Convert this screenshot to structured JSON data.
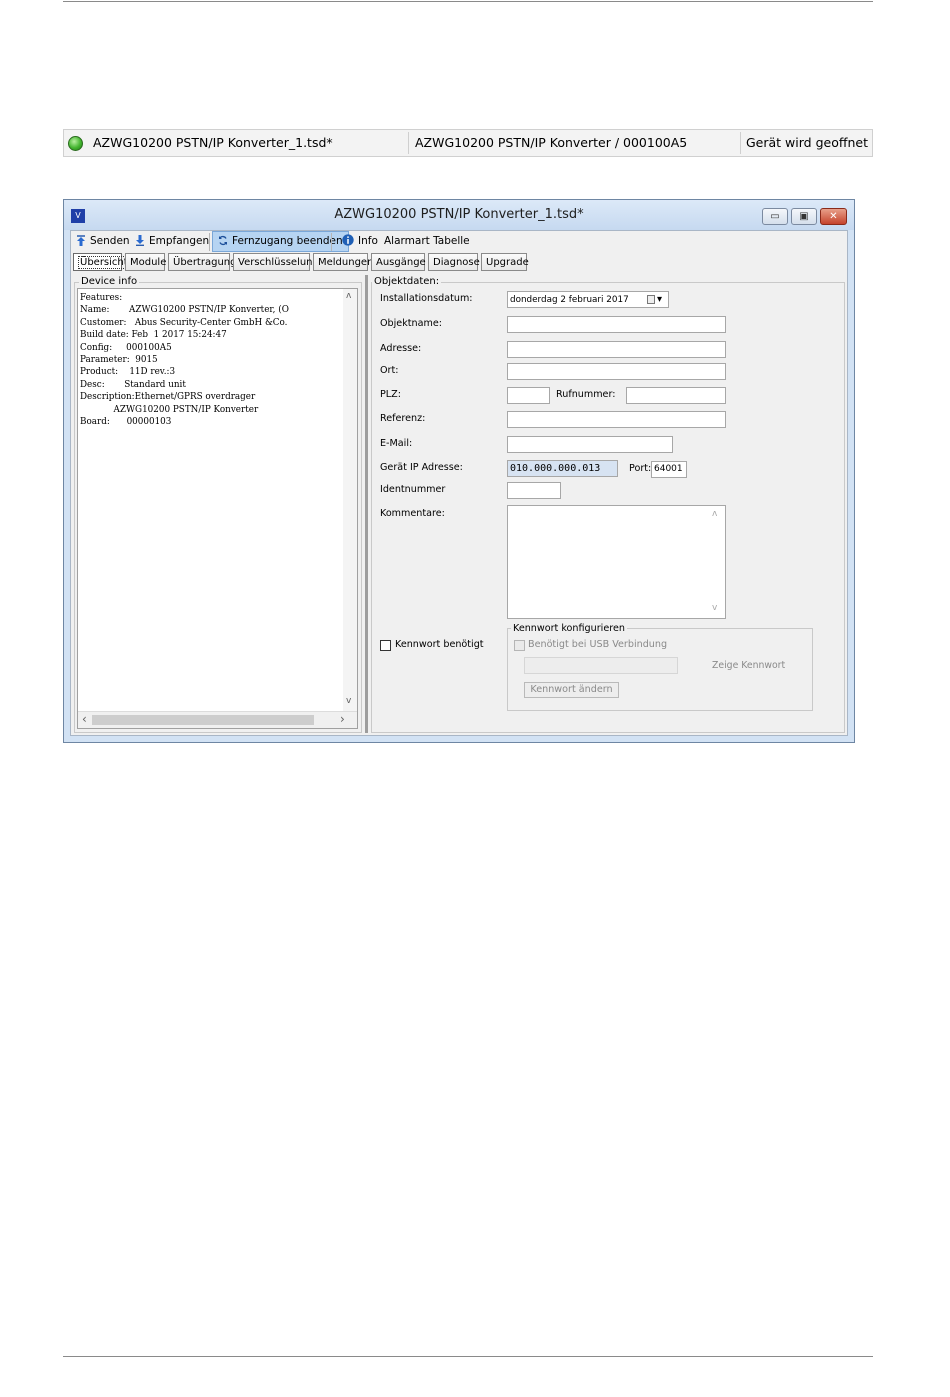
{
  "statusbar": {
    "file_name": "AZWG10200 PSTN/IP Konverter_1.tsd*",
    "device": "AZWG10200 PSTN/IP Konverter / 000100A5",
    "status": "Gerät wird geoffnet"
  },
  "window": {
    "app_icon_text": "V",
    "title": "AZWG10200 PSTN/IP Konverter_1.tsd*",
    "minimize_glyph": "▭",
    "maximize_glyph": "▣",
    "close_glyph": "✕"
  },
  "toolbar": {
    "send": "Senden",
    "receive": "Empfangen",
    "remote_end": "Fernzugang beenden",
    "info": "Info",
    "alarm_table": "Alarmart Tabelle"
  },
  "tabs": [
    "Übersicht",
    "Module",
    "Übertragung",
    "Verschlüsselung",
    "Meldungen",
    "Ausgänge",
    "Diagnose",
    "Upgrade"
  ],
  "device_info": {
    "title": "Device info",
    "text": "Features:\nName:       AZWG10200 PSTN/IP Konverter, (O\nCustomer:   Abus Security-Center GmbH &Co.\nBuild date: Feb  1 2017 15:24:47\nConfig:     000100A5\nParameter:  9015\nProduct:    11D rev.:3\nDesc:       Standard unit\nDescription:Ethernet/GPRS overdrager\n            AZWG10200 PSTN/IP Konverter\nBoard:      00000103",
    "scroll_left": "‹",
    "scroll_right": "›",
    "scroll_up": "ʌ",
    "scroll_down": "v"
  },
  "object_data": {
    "title": "Objektdaten:",
    "install_date_label": "Installationsdatum:",
    "install_date_value": "donderdag  2  februari  2017",
    "dropdown_glyph": "▾",
    "object_name_label": "Objektname:",
    "address_label": "Adresse:",
    "city_label": "Ort:",
    "zip_label": "PLZ:",
    "phone_label": "Rufnummer:",
    "reference_label": "Referenz:",
    "email_label": "E-Mail:",
    "ip_label": "Gerät IP Adresse:",
    "ip_value": "010.000.000.013",
    "port_label": "Port:",
    "port_value": "64001",
    "ident_label": "Identnummer",
    "comments_label": "Kommentare:",
    "comments_scroll_up": "ʌ",
    "comments_scroll_down": "v"
  },
  "password": {
    "required_label": "Kennwort benötigt",
    "group_title": "Kennwort konfigurieren",
    "usb_label": "Benötigt bei USB Verbindung",
    "show_password": "Zeige Kennwort",
    "change_button": "Kennwort ändern"
  }
}
